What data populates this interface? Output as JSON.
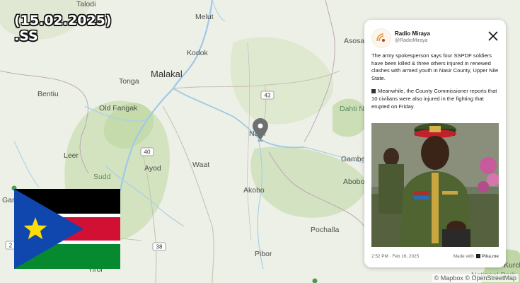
{
  "overlay": {
    "date": "(15.02.2025)",
    "suffix": ".SS"
  },
  "map": {
    "places": {
      "talodi": "Talodi",
      "melut": "Melut",
      "kodok": "Kodok",
      "malakal": "Malakal",
      "tonga": "Tonga",
      "bentiu": "Bentiu",
      "old_fangak": "Old Fangak",
      "leer": "Leer",
      "sudd": "Sudd",
      "ayod": "Ayod",
      "waat": "Waat",
      "nasir": "Nasir",
      "akobo": "Akobo",
      "pochalla": "Pochalla",
      "pibor": "Pibor",
      "yirol": "Yirol",
      "asosa": "Asosa",
      "dahti": "Dahti N",
      "gambe": "Gambe",
      "abobo": "Abobo",
      "gar": "Gar",
      "national_park": "National Park",
      "kurch": "Kurch"
    },
    "routes": [
      "43",
      "40",
      "38",
      "2"
    ],
    "marker": "location-pin"
  },
  "post": {
    "account_name": "Radio Miraya",
    "account_handle": "@RadioMiraya",
    "paragraph1": "The army spokesperson says four SSPDF soldiers have been killed & three others injured in renewed clashes with armed youth in Nasir County, Upper Nile State.",
    "paragraph2": "Meanwhile, the County Commissioner reports that 10 civilians were also injured in the fighting that erupted on Friday.",
    "timestamp": "2:52 PM · Feb 16, 2025",
    "made_with": "Made with",
    "made_with_brand": "Pika.me"
  },
  "attribution": "© Mapbox © OpenStreetMap",
  "colors": {
    "flag_black": "#000000",
    "flag_red": "#d21034",
    "flag_green": "#078930",
    "flag_blue": "#0f47af",
    "flag_star": "#fcdd09",
    "river": "#9fc9e8",
    "wetland": "#c9dcb2"
  }
}
